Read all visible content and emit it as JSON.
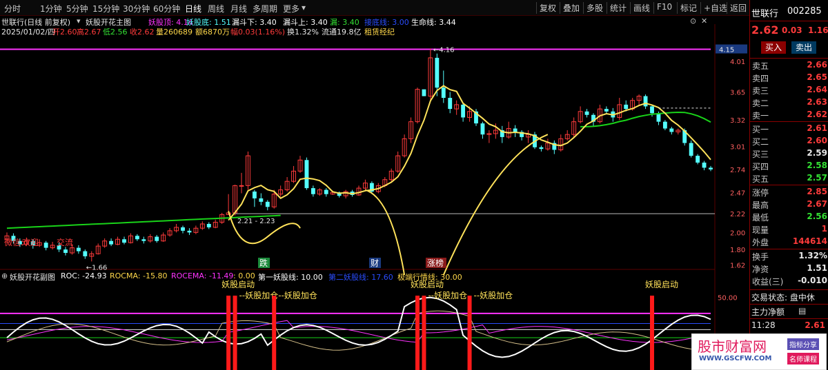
{
  "toolbar": {
    "left_items": [
      "分时",
      "1分钟",
      "5分钟",
      "15分钟",
      "30分钟",
      "60分钟",
      "日线",
      "周线",
      "月线",
      "多周期",
      "更多"
    ],
    "active": "日线",
    "right_items": [
      "复权",
      "叠加",
      "多股",
      "统计",
      "画线",
      "F10",
      "标记",
      "+自选",
      "返回"
    ]
  },
  "header": {
    "title": "世联行(日线 前复权)",
    "formula_name": "妖股开花主图",
    "yaogu_top": "妖股顶: 4.14",
    "yaogu_bottom": "妖股底: 1.51",
    "loudou_down": "漏斗下: 3.40",
    "loudou_up": "漏斗上: 3.40",
    "loudou": "漏: 3.40",
    "jiedi_line": "接底线: 3.00",
    "life_line": "生命线: 3.44",
    "date": "2025/01/02/四",
    "open": "开2.60",
    "high": "高2.67",
    "low": "低2.56",
    "close": "收2.62",
    "volume": "量260689",
    "amount": "额6870万",
    "change": "幅0.03(1.16%)",
    "turnover": "换1.32%",
    "float_cap": "流通19.8亿",
    "sector": "租赁经纪"
  },
  "chart_data": {
    "type": "candlestick",
    "price_axis": {
      "ticks": [
        "4.15",
        "4.01",
        "3.65",
        "3.32",
        "3.01",
        "2.74",
        "2.47",
        "2.22",
        "2.00",
        "1.80",
        "1.62"
      ],
      "range": [
        1.55,
        4.3
      ]
    },
    "highest_label": "4.16",
    "lowest_label": "1.66",
    "range_label": "2.21 - 2.23",
    "reference_level": 2.22,
    "annotations": [
      "微信:",
      "欢迎",
      "交流"
    ],
    "chart_tags": [
      "跌",
      "财",
      "涨榜"
    ],
    "candles": [
      [
        1.92,
        1.96,
        2.0,
        1.88
      ],
      [
        1.96,
        1.9,
        1.99,
        1.87
      ],
      [
        1.9,
        1.86,
        1.93,
        1.83
      ],
      [
        1.86,
        1.9,
        1.94,
        1.84
      ],
      [
        1.9,
        1.85,
        1.92,
        1.81
      ],
      [
        1.85,
        1.88,
        1.92,
        1.83
      ],
      [
        1.88,
        1.82,
        1.9,
        1.79
      ],
      [
        1.82,
        1.85,
        1.89,
        1.8
      ],
      [
        1.85,
        1.8,
        1.88,
        1.77
      ],
      [
        1.8,
        1.76,
        1.83,
        1.73
      ],
      [
        1.76,
        1.82,
        1.86,
        1.74
      ],
      [
        1.82,
        1.78,
        1.85,
        1.75
      ],
      [
        1.78,
        1.72,
        1.8,
        1.69
      ],
      [
        1.72,
        1.75,
        1.78,
        1.66
      ],
      [
        1.75,
        1.84,
        1.87,
        1.74
      ],
      [
        1.84,
        1.9,
        1.93,
        1.82
      ],
      [
        1.9,
        1.86,
        1.93,
        1.84
      ],
      [
        1.86,
        1.92,
        1.95,
        1.85
      ],
      [
        1.92,
        1.88,
        1.95,
        1.86
      ],
      [
        1.88,
        1.96,
        1.99,
        1.87
      ],
      [
        1.96,
        1.92,
        1.98,
        1.9
      ],
      [
        1.92,
        1.9,
        1.95,
        1.87
      ],
      [
        1.9,
        1.95,
        1.98,
        1.88
      ],
      [
        1.95,
        1.9,
        1.97,
        1.88
      ],
      [
        1.9,
        1.97,
        2.0,
        1.89
      ],
      [
        1.97,
        2.02,
        2.05,
        1.95
      ],
      [
        2.02,
        2.06,
        2.1,
        2.0
      ],
      [
        2.06,
        2.02,
        2.08,
        1.99
      ],
      [
        2.02,
        2.0,
        2.05,
        1.97
      ],
      [
        2.0,
        2.05,
        2.08,
        1.98
      ],
      [
        2.05,
        2.1,
        2.13,
        2.03
      ],
      [
        2.1,
        2.06,
        2.12,
        2.04
      ],
      [
        2.06,
        2.12,
        2.15,
        2.05
      ],
      [
        2.12,
        2.21,
        2.23,
        2.1
      ],
      [
        2.21,
        2.23,
        2.45,
        2.21
      ],
      [
        2.23,
        2.55,
        2.56,
        2.2
      ],
      [
        2.55,
        2.55,
        2.7,
        2.46
      ],
      [
        2.55,
        2.9,
        2.95,
        2.5
      ],
      [
        2.48,
        2.4,
        2.5,
        2.3
      ],
      [
        2.4,
        2.36,
        2.46,
        2.32
      ],
      [
        2.36,
        2.3,
        2.38,
        2.26
      ],
      [
        2.3,
        2.45,
        2.5,
        2.28
      ],
      [
        2.45,
        2.5,
        2.55,
        2.42
      ],
      [
        2.5,
        2.6,
        2.65,
        2.48
      ],
      [
        2.6,
        2.72,
        2.78,
        2.58
      ],
      [
        2.72,
        2.85,
        2.9,
        2.7
      ],
      [
        2.85,
        2.52,
        2.88,
        2.5
      ],
      [
        2.52,
        2.45,
        2.55,
        2.42
      ],
      [
        2.45,
        2.5,
        2.52,
        2.43
      ],
      [
        2.5,
        2.45,
        2.52,
        2.42
      ],
      [
        2.45,
        2.47,
        2.49,
        2.44
      ],
      [
        2.47,
        2.43,
        2.48,
        2.41
      ],
      [
        2.43,
        2.48,
        2.5,
        2.4
      ],
      [
        2.48,
        2.44,
        2.5,
        2.42
      ],
      [
        2.44,
        2.52,
        2.55,
        2.43
      ],
      [
        2.52,
        2.58,
        2.62,
        2.5
      ],
      [
        2.58,
        2.48,
        2.6,
        2.46
      ],
      [
        2.48,
        2.55,
        2.58,
        2.46
      ],
      [
        2.55,
        2.62,
        2.65,
        2.53
      ],
      [
        2.62,
        2.72,
        2.75,
        2.6
      ],
      [
        2.72,
        2.9,
        2.95,
        2.7
      ],
      [
        2.9,
        3.1,
        3.15,
        2.88
      ],
      [
        3.1,
        3.3,
        3.35,
        3.05
      ],
      [
        3.3,
        3.68,
        3.7,
        3.28
      ],
      [
        3.68,
        3.6,
        3.62,
        3.6
      ],
      [
        3.6,
        4.05,
        4.16,
        3.55
      ],
      [
        4.05,
        3.7,
        4.1,
        3.6
      ],
      [
        3.7,
        3.58,
        3.9,
        3.52
      ],
      [
        3.58,
        3.45,
        3.65,
        3.4
      ],
      [
        3.45,
        3.5,
        3.55,
        3.38
      ],
      [
        3.5,
        3.35,
        3.52,
        3.3
      ],
      [
        3.35,
        3.42,
        3.48,
        3.3
      ],
      [
        3.42,
        3.28,
        3.45,
        3.25
      ],
      [
        3.28,
        3.15,
        3.3,
        3.1
      ],
      [
        3.15,
        3.16,
        3.2,
        3.05
      ],
      [
        3.16,
        3.2,
        3.28,
        3.1
      ],
      [
        3.2,
        3.12,
        3.25,
        3.05
      ],
      [
        3.12,
        3.22,
        3.3,
        3.1
      ],
      [
        3.22,
        3.18,
        3.26,
        3.12
      ],
      [
        3.18,
        3.12,
        3.2,
        3.08
      ],
      [
        3.12,
        3.15,
        3.2,
        3.05
      ],
      [
        3.15,
        3.0,
        3.18,
        2.98
      ],
      [
        3.0,
        2.98,
        3.02,
        2.95
      ],
      [
        2.98,
        3.05,
        3.1,
        2.96
      ],
      [
        3.05,
        2.97,
        3.08,
        2.92
      ],
      [
        2.97,
        3.1,
        3.15,
        2.95
      ],
      [
        3.1,
        3.15,
        3.2,
        3.08
      ],
      [
        3.15,
        3.3,
        3.35,
        3.12
      ],
      [
        3.3,
        3.42,
        3.48,
        3.28
      ],
      [
        3.42,
        3.38,
        3.45,
        3.35
      ],
      [
        3.38,
        3.3,
        3.4,
        3.25
      ],
      [
        3.3,
        3.45,
        3.5,
        3.28
      ],
      [
        3.45,
        3.42,
        3.48,
        3.4
      ],
      [
        3.42,
        3.35,
        3.46,
        3.3
      ],
      [
        3.35,
        3.5,
        3.58,
        3.32
      ],
      [
        3.5,
        3.45,
        3.55,
        3.42
      ],
      [
        3.45,
        3.55,
        3.58,
        3.43
      ],
      [
        3.55,
        3.6,
        3.62,
        3.5
      ],
      [
        3.6,
        3.48,
        3.62,
        3.45
      ],
      [
        3.48,
        3.4,
        3.5,
        3.36
      ],
      [
        3.4,
        3.3,
        3.42,
        3.26
      ],
      [
        3.3,
        3.22,
        3.32,
        3.2
      ],
      [
        3.22,
        3.18,
        3.24,
        3.15
      ],
      [
        3.18,
        3.2,
        3.22,
        3.15
      ],
      [
        3.2,
        3.05,
        3.22,
        3.02
      ],
      [
        3.05,
        2.9,
        3.08,
        2.88
      ],
      [
        2.9,
        2.82,
        2.92,
        2.8
      ],
      [
        2.82,
        2.76,
        2.84,
        2.73
      ],
      [
        2.76,
        2.74,
        2.78,
        2.72
      ]
    ],
    "sub_indicator": {
      "title": "妖股开花副图",
      "roc": "ROC: -24.93",
      "rocma": "ROCMA: -15.80",
      "rocema": "ROCEMA: -11.49",
      "zero": ": 0.00",
      "line1": "第一妖股线: 10.00",
      "line2": "第二妖股线: 17.60",
      "extreme": "极端行情线: 30.00",
      "axis_label": "50.00",
      "signal_labels": [
        "妖股启动",
        "妖股加仓",
        "妖股加仓",
        "妖股启动",
        "妖股加仓",
        "妖股加仓",
        "妖股启动"
      ]
    }
  },
  "right_panel": {
    "name": "世联行",
    "code": "002285",
    "price": "2.62",
    "change": "0.03",
    "change_pct": "1.16",
    "buy_btn": "买入",
    "sell_btn": "卖出",
    "sell_levels": [
      {
        "label": "卖五",
        "price": "2.66"
      },
      {
        "label": "卖四",
        "price": "2.65"
      },
      {
        "label": "卖三",
        "price": "2.64"
      },
      {
        "label": "卖二",
        "price": "2.63"
      },
      {
        "label": "卖一",
        "price": "2.62"
      }
    ],
    "buy_levels": [
      {
        "label": "买一",
        "price": "2.61"
      },
      {
        "label": "买二",
        "price": "2.60"
      },
      {
        "label": "买三",
        "price": "2.59"
      },
      {
        "label": "买四",
        "price": "2.58"
      },
      {
        "label": "买五",
        "price": "2.57"
      }
    ],
    "stats": [
      {
        "label": "涨停",
        "value": "2.85"
      },
      {
        "label": "最高",
        "value": "2.67"
      },
      {
        "label": "最低",
        "value": "2.56"
      },
      {
        "label": "现量",
        "value": "1"
      },
      {
        "label": "外盘",
        "value": "144614"
      }
    ],
    "stats2": [
      {
        "label": "换手",
        "value": "1.32%"
      },
      {
        "label": "净资",
        "value": "1.51"
      },
      {
        "label": "收益(三)",
        "value": "-0.010"
      }
    ],
    "trade_status": "交易状态: 盘中休",
    "main_flow": "主力净额",
    "last_time": "11:28",
    "last_price": "2.61"
  },
  "watermark": {
    "title": "股市财富网",
    "url": "WWW.GSCFW.COM",
    "tag1": "指标分享",
    "tag2": "名师课程"
  },
  "colors": {
    "up": "#ff3b3b",
    "down": "#54ffff",
    "yellow_line": "#ffe25a",
    "green_line": "#19d419",
    "magenta_line": "#ff33ff",
    "signal_red": "#ff1a1a"
  }
}
